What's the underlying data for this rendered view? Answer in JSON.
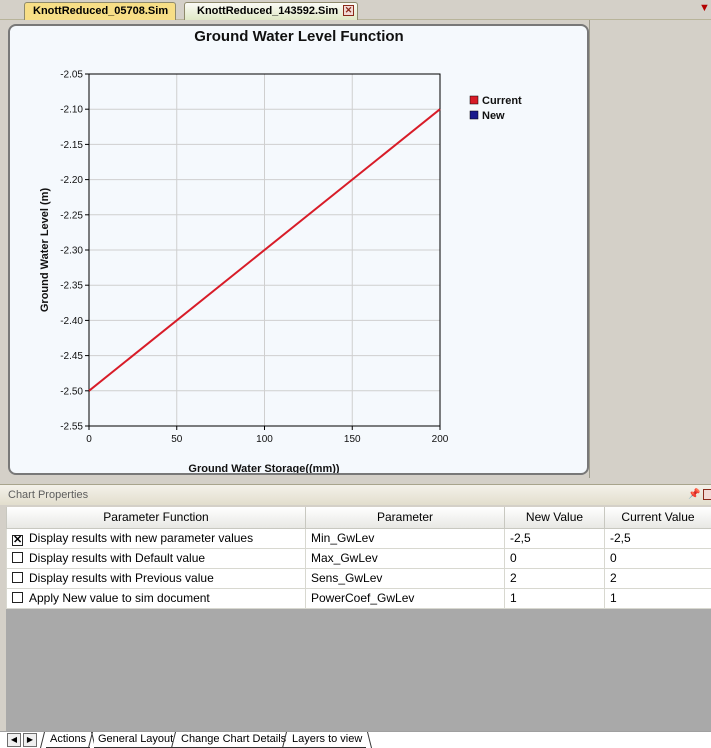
{
  "tabs": [
    {
      "label": "KnottReduced_05708.Sim",
      "active": false
    },
    {
      "label": "KnottReduced_143592.Sim",
      "active": true
    }
  ],
  "chart_data": {
    "type": "line",
    "title": "Ground Water Level Function",
    "xlabel": "Ground Water Storage((mm))",
    "ylabel": "Ground Water Level (m)",
    "xlim": [
      0,
      200
    ],
    "ylim": [
      -2.55,
      -2.05
    ],
    "x_ticks": [
      "0",
      "50",
      "100",
      "150",
      "200"
    ],
    "y_ticks": [
      "-2.05",
      "-2.10",
      "-2.15",
      "-2.20",
      "-2.25",
      "-2.30",
      "-2.35",
      "-2.40",
      "-2.45",
      "-2.50",
      "-2.55"
    ],
    "grid": true,
    "legend_position": "right",
    "series": [
      {
        "name": "Current",
        "color": "#d81c28",
        "x": [
          0,
          200
        ],
        "y": [
          -2.5,
          -2.1
        ]
      },
      {
        "name": "New",
        "color": "#1a1a8c",
        "x": [],
        "y": []
      }
    ]
  },
  "props": {
    "title": "Chart Properties",
    "columns": [
      "Parameter Function",
      "Parameter",
      "New Value",
      "Current Value"
    ],
    "rows": [
      {
        "checked": true,
        "function": "Display results with new parameter values",
        "parameter": "Min_GwLev",
        "new_value": "-2,5",
        "current_value": "-2,5"
      },
      {
        "checked": false,
        "function": "Display results with Default value",
        "parameter": "Max_GwLev",
        "new_value": "0",
        "current_value": "0"
      },
      {
        "checked": false,
        "function": "Display results with Previous value",
        "parameter": "Sens_GwLev",
        "new_value": "2",
        "current_value": "2"
      },
      {
        "checked": false,
        "function": "Apply New value to sim document",
        "parameter": "PowerCoef_GwLev",
        "new_value": "1",
        "current_value": "1"
      }
    ]
  },
  "bottom_tabs": [
    "Actions",
    "General Layout",
    "Change Chart Details",
    "Layers to view"
  ],
  "icons": {
    "checked_mark": "✕",
    "pin": "pin-icon",
    "close": "close-icon",
    "nav_prev": "◀",
    "nav_next": "▶"
  }
}
